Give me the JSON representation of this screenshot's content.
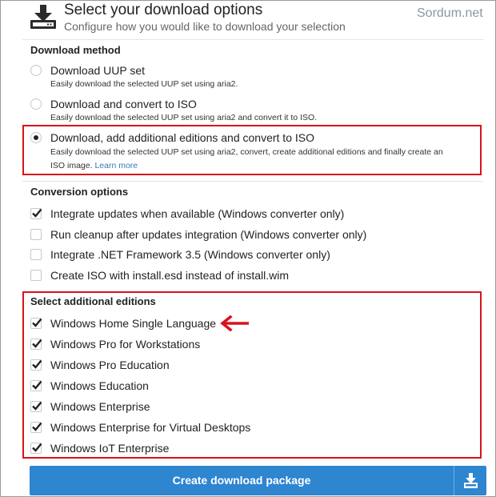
{
  "header": {
    "title": "Select your download options",
    "subtitle": "Configure how you would like to download your selection",
    "watermark": "Sordum.net"
  },
  "download_method": {
    "title": "Download method",
    "options": [
      {
        "label": "Download UUP set",
        "description": "Easily download the selected UUP set using aria2.",
        "selected": false
      },
      {
        "label": "Download and convert to ISO",
        "description": "Easily download the selected UUP set using aria2 and convert it to ISO.",
        "selected": false
      },
      {
        "label": "Download, add additional editions and convert to ISO",
        "description": "Easily download the selected UUP set using aria2, convert, create additional editions and finally create an",
        "description2": "ISO image.",
        "link": "Learn more",
        "selected": true
      }
    ]
  },
  "conversion_options": {
    "title": "Conversion options",
    "items": [
      {
        "label": "Integrate updates when available (Windows converter only)",
        "checked": true
      },
      {
        "label": "Run cleanup after updates integration (Windows converter only)",
        "checked": false
      },
      {
        "label": "Integrate .NET Framework 3.5 (Windows converter only)",
        "checked": false
      },
      {
        "label": "Create ISO with install.esd instead of install.wim",
        "checked": false
      }
    ]
  },
  "additional_editions": {
    "title": "Select additional editions",
    "items": [
      {
        "label": "Windows Home Single Language",
        "checked": true
      },
      {
        "label": "Windows Pro for Workstations",
        "checked": true
      },
      {
        "label": "Windows Pro Education",
        "checked": true
      },
      {
        "label": "Windows Education",
        "checked": true
      },
      {
        "label": "Windows Enterprise",
        "checked": true
      },
      {
        "label": "Windows Enterprise for Virtual Desktops",
        "checked": true
      },
      {
        "label": "Windows IoT Enterprise",
        "checked": true
      }
    ]
  },
  "create_button": {
    "label": "Create download package"
  },
  "colors": {
    "accent": "#2e85d0",
    "highlight": "#d9121a",
    "link": "#2e7bc0"
  },
  "icons": {
    "header": "download-tray-icon",
    "button": "download-icon",
    "annotation": "left-arrow-icon"
  }
}
